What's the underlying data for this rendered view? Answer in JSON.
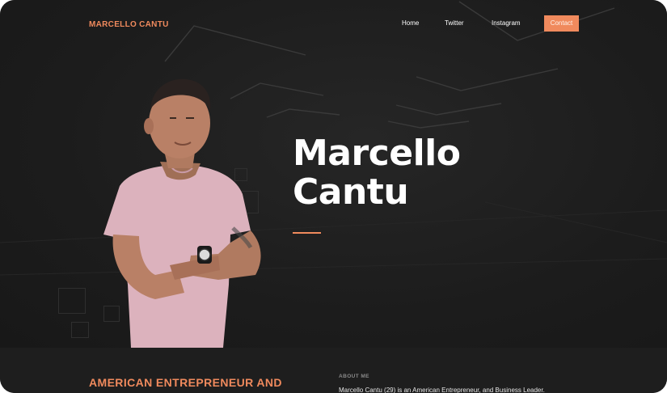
{
  "header": {
    "brand": "MARCELLO CANTU",
    "nav": {
      "home": "Home",
      "twitter": "Twitter",
      "instagram": "Instagram",
      "contact": "Contact"
    }
  },
  "hero": {
    "title_line1": "Marcello",
    "title_line2": "Cantu"
  },
  "about": {
    "tagline": "AMERICAN ENTREPRENEUR AND",
    "label": "ABOUT ME",
    "text": "Marcello Cantu (29) is an American Entrepreneur, and Business Leader."
  },
  "colors": {
    "accent": "#f08a5d",
    "background": "#1d1d1d",
    "text": "#ffffff"
  }
}
